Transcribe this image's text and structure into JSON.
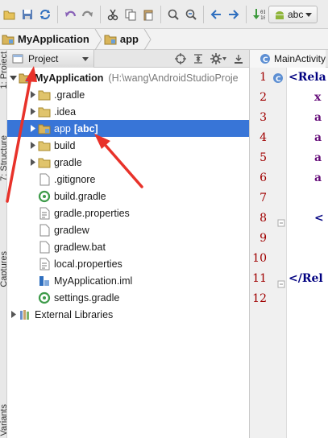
{
  "breadcrumb": {
    "items": [
      {
        "label": "MyApplication",
        "icon": "module-folder-icon"
      },
      {
        "label": "app",
        "icon": "module-folder-icon"
      }
    ]
  },
  "toolbar": {
    "device_combo": "abc"
  },
  "project_panel": {
    "view_selector": "Project",
    "tree": [
      {
        "label": "MyApplication",
        "extra": "(H:\\wang\\AndroidStudioProje",
        "icon": "module-folder-icon",
        "depth": 0,
        "expanded": true,
        "bold": true
      },
      {
        "label": ".gradle",
        "icon": "folder-icon",
        "depth": 1,
        "expanded": false
      },
      {
        "label": ".idea",
        "icon": "folder-icon",
        "depth": 1,
        "expanded": false
      },
      {
        "label": "app",
        "badge": "[abc]",
        "icon": "module-folder-icon",
        "depth": 1,
        "expanded": false,
        "selected": true
      },
      {
        "label": "build",
        "icon": "folder-icon",
        "depth": 1,
        "expanded": false
      },
      {
        "label": "gradle",
        "icon": "folder-icon",
        "depth": 1,
        "expanded": false
      },
      {
        "label": ".gitignore",
        "icon": "file-icon",
        "depth": 1
      },
      {
        "label": "build.gradle",
        "icon": "gradle-file-icon",
        "depth": 1
      },
      {
        "label": "gradle.properties",
        "icon": "properties-file-icon",
        "depth": 1
      },
      {
        "label": "gradlew",
        "icon": "file-icon",
        "depth": 1
      },
      {
        "label": "gradlew.bat",
        "icon": "file-icon",
        "depth": 1
      },
      {
        "label": "local.properties",
        "icon": "properties-file-icon",
        "depth": 1
      },
      {
        "label": "MyApplication.iml",
        "icon": "iml-file-icon",
        "depth": 1
      },
      {
        "label": "settings.gradle",
        "icon": "gradle-file-icon",
        "depth": 1
      },
      {
        "label": "External Libraries",
        "icon": "libraries-icon",
        "depth": 0,
        "expanded": false
      }
    ]
  },
  "side_stripe": {
    "labels": [
      "1: Project",
      "7: Structure",
      "Captures",
      "Build Variants"
    ]
  },
  "editor": {
    "tab": "MainActivity",
    "lines": [
      {
        "no": "1",
        "text": "<Rela"
      },
      {
        "no": "2",
        "text": "x"
      },
      {
        "no": "3",
        "text": "a"
      },
      {
        "no": "4",
        "text": "a"
      },
      {
        "no": "5",
        "text": "a"
      },
      {
        "no": "6",
        "text": "a"
      },
      {
        "no": "7",
        "text": ""
      },
      {
        "no": "8",
        "text": "<"
      },
      {
        "no": "9",
        "text": ""
      },
      {
        "no": "10",
        "text": ""
      },
      {
        "no": "11",
        "text": "</Rel"
      },
      {
        "no": "12",
        "text": ""
      }
    ]
  },
  "colors": {
    "selection": "#3875d7",
    "annotation_arrow": "#e8322a",
    "line_number": "#a00000",
    "xml_tag": "#000080"
  }
}
